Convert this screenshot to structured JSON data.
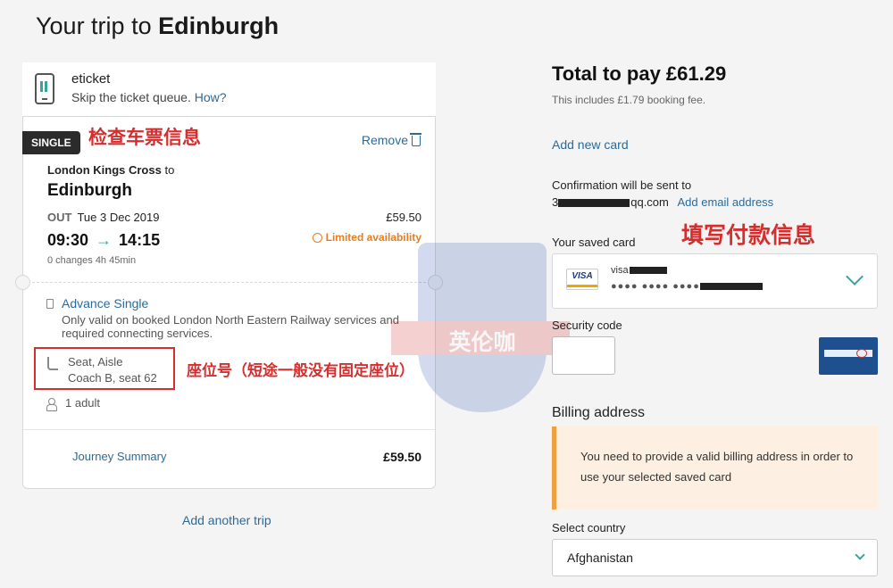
{
  "header": {
    "title_prefix": "Your trip to",
    "title_city": "Edinburgh"
  },
  "eticket": {
    "title": "eticket",
    "subtitle": "Skip the ticket queue.",
    "how_link": "How?"
  },
  "journey": {
    "badge": "SINGLE",
    "annotation_check": "检查车票信息",
    "remove_label": "Remove",
    "origin": "London Kings Cross",
    "to_word": "to",
    "destination": "Edinburgh",
    "direction": "OUT",
    "date": "Tue 3 Dec 2019",
    "price": "£59.50",
    "depart": "09:30",
    "arrive": "14:15",
    "availability": "Limited availability",
    "changes": "0 changes 4h 45min",
    "fare_name": "Advance Single",
    "fare_desc": "Only valid on booked London North Eastern Railway services and required connecting services.",
    "seat_line1": "Seat, Aisle",
    "seat_line2": "Coach B, seat 62",
    "annotation_seat": "座位号（短途一般没有固定座位）",
    "passengers": "1 adult",
    "summary_label": "Journey Summary",
    "summary_price": "£59.50"
  },
  "add_trip": "Add another trip",
  "watermark": {
    "text": "英伦咖"
  },
  "payment": {
    "total": "Total to pay £61.29",
    "fee_note": "This includes £1.79 booking fee.",
    "add_card": "Add new card",
    "confirmation": "Confirmation will be sent to",
    "email_prefix": "3",
    "email_suffix": "qq.com",
    "add_email": "Add email address",
    "annotation_fill": "填写付款信息",
    "saved_card_label": "Your saved card",
    "card_brand": "VISA",
    "card_name_prefix": "visa",
    "card_number": "●●●● ●●●● ●●●●",
    "security_label": "Security code",
    "billing_title": "Billing address",
    "billing_alert": "You need to provide a valid billing address in order to use your selected saved card",
    "country_label": "Select country",
    "country_value": "Afghanistan"
  }
}
